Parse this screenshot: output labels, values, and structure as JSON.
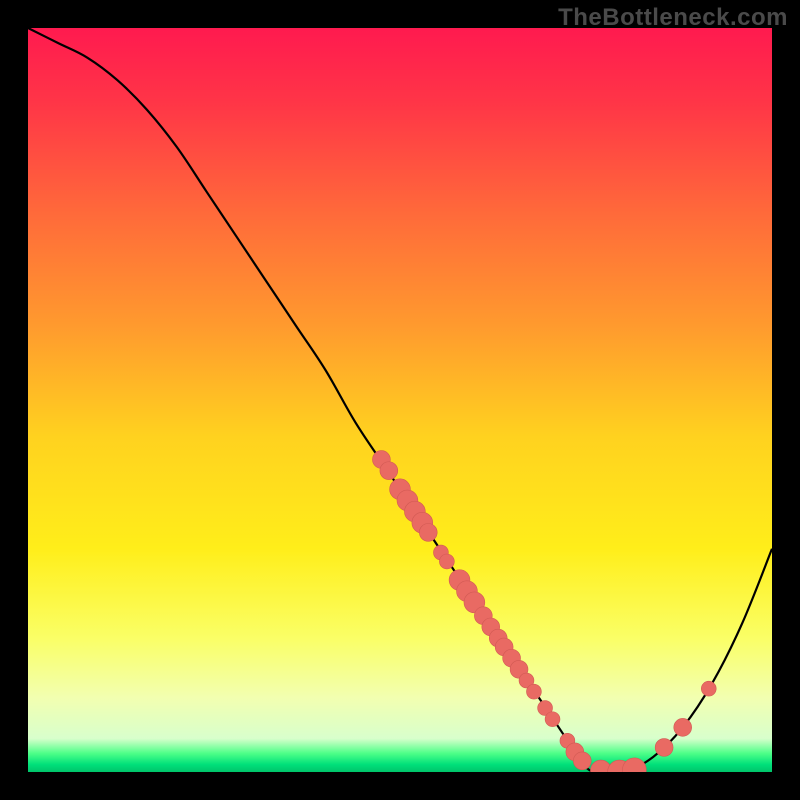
{
  "watermark": "TheBottleneck.com",
  "colors": {
    "background": "#000000",
    "gradient_stops": [
      {
        "offset": 0.0,
        "color": "#ff1a4f"
      },
      {
        "offset": 0.1,
        "color": "#ff3547"
      },
      {
        "offset": 0.25,
        "color": "#ff6a3a"
      },
      {
        "offset": 0.4,
        "color": "#ff9a2e"
      },
      {
        "offset": 0.55,
        "color": "#ffd21f"
      },
      {
        "offset": 0.7,
        "color": "#ffee1a"
      },
      {
        "offset": 0.82,
        "color": "#faff66"
      },
      {
        "offset": 0.9,
        "color": "#f2ffb0"
      },
      {
        "offset": 0.955,
        "color": "#d8ffcc"
      },
      {
        "offset": 0.975,
        "color": "#4dff88"
      },
      {
        "offset": 0.99,
        "color": "#00e07a"
      },
      {
        "offset": 1.0,
        "color": "#00c46a"
      }
    ],
    "curve": "#000000",
    "marker_fill": "#e96a63",
    "marker_stroke": "#d25a54"
  },
  "chart_data": {
    "type": "line",
    "title": "",
    "xlabel": "",
    "ylabel": "",
    "xlim": [
      0,
      100
    ],
    "ylim": [
      0,
      100
    ],
    "grid": false,
    "legend": false,
    "series": [
      {
        "name": "curve",
        "x": [
          0,
          4,
          8,
          12,
          16,
          20,
          24,
          28,
          32,
          36,
          40,
          44,
          48,
          52,
          56,
          60,
          64,
          68,
          72,
          74,
          76,
          80,
          84,
          88,
          92,
          96,
          100
        ],
        "y": [
          100,
          98,
          96,
          93,
          89,
          84,
          78,
          72,
          66,
          60,
          54,
          47,
          41,
          35,
          29,
          23,
          17,
          11,
          5,
          2,
          0,
          0,
          2,
          6,
          12,
          20,
          30
        ]
      }
    ],
    "markers": [
      {
        "x": 47.5,
        "y": 42.0,
        "r": 1.2
      },
      {
        "x": 48.5,
        "y": 40.5,
        "r": 1.2
      },
      {
        "x": 50.0,
        "y": 38.0,
        "r": 1.4
      },
      {
        "x": 51.0,
        "y": 36.5,
        "r": 1.4
      },
      {
        "x": 52.0,
        "y": 35.0,
        "r": 1.4
      },
      {
        "x": 53.0,
        "y": 33.5,
        "r": 1.4
      },
      {
        "x": 53.8,
        "y": 32.2,
        "r": 1.2
      },
      {
        "x": 55.5,
        "y": 29.5,
        "r": 1.0
      },
      {
        "x": 56.3,
        "y": 28.3,
        "r": 1.0
      },
      {
        "x": 58.0,
        "y": 25.8,
        "r": 1.4
      },
      {
        "x": 59.0,
        "y": 24.3,
        "r": 1.4
      },
      {
        "x": 60.0,
        "y": 22.8,
        "r": 1.4
      },
      {
        "x": 61.2,
        "y": 21.0,
        "r": 1.2
      },
      {
        "x": 62.2,
        "y": 19.5,
        "r": 1.2
      },
      {
        "x": 63.2,
        "y": 18.0,
        "r": 1.2
      },
      {
        "x": 64.0,
        "y": 16.8,
        "r": 1.2
      },
      {
        "x": 65.0,
        "y": 15.3,
        "r": 1.2
      },
      {
        "x": 66.0,
        "y": 13.8,
        "r": 1.2
      },
      {
        "x": 67.0,
        "y": 12.3,
        "r": 1.0
      },
      {
        "x": 68.0,
        "y": 10.8,
        "r": 1.0
      },
      {
        "x": 69.5,
        "y": 8.6,
        "r": 1.0
      },
      {
        "x": 70.5,
        "y": 7.1,
        "r": 1.0
      },
      {
        "x": 72.5,
        "y": 4.2,
        "r": 1.0
      },
      {
        "x": 73.5,
        "y": 2.7,
        "r": 1.2
      },
      {
        "x": 74.5,
        "y": 1.5,
        "r": 1.2
      },
      {
        "x": 77.0,
        "y": 0.2,
        "r": 1.4
      },
      {
        "x": 79.5,
        "y": 0.0,
        "r": 1.6
      },
      {
        "x": 81.5,
        "y": 0.3,
        "r": 1.6
      },
      {
        "x": 85.5,
        "y": 3.3,
        "r": 1.2
      },
      {
        "x": 88.0,
        "y": 6.0,
        "r": 1.2
      },
      {
        "x": 91.5,
        "y": 11.2,
        "r": 1.0
      }
    ]
  }
}
